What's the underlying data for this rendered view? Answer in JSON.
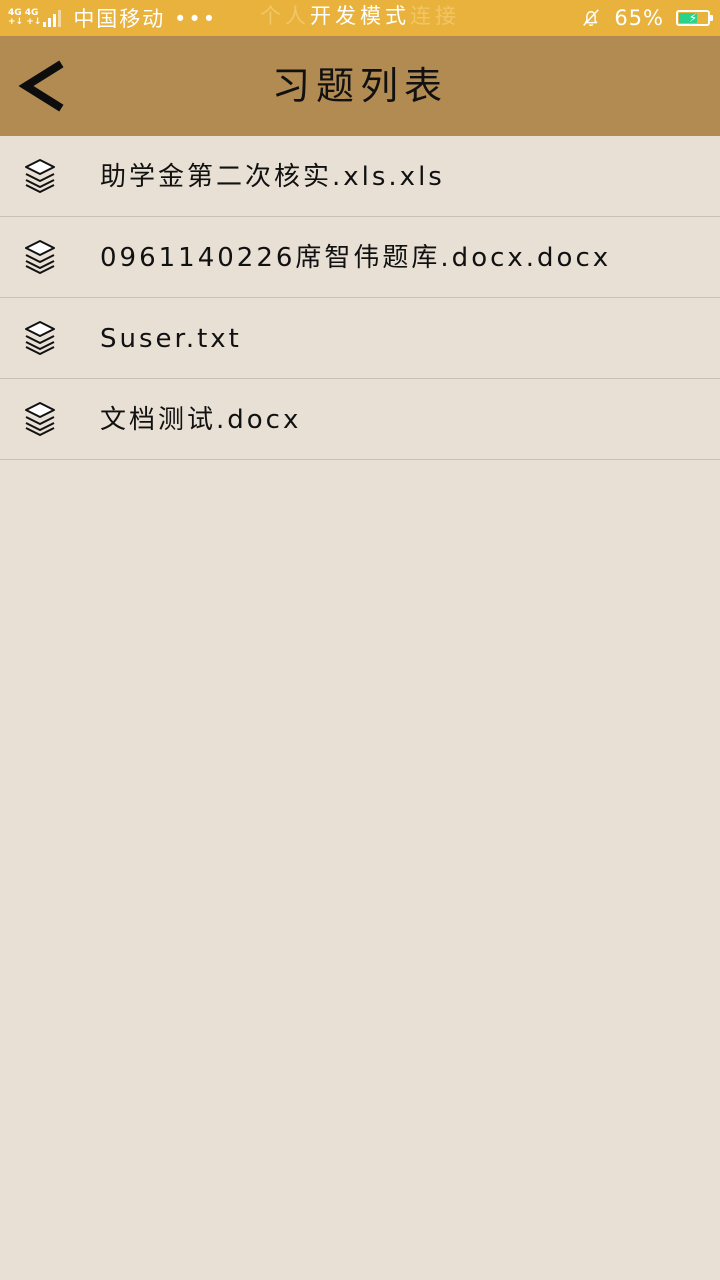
{
  "status_bar": {
    "network_top": "4G 4G",
    "network_bottom": "+↓ +↓",
    "carrier": "中国移动 •••",
    "center_ghost_left": "个人",
    "center_text": "开发模式",
    "center_ghost_right": "连接",
    "battery_percent": "65%",
    "battery_level": 0.65,
    "battery_color": "#2bd38a",
    "icons": [
      "signal-icon",
      "bell-muted-icon",
      "battery-charging-icon"
    ]
  },
  "header": {
    "back_icon": "chevron-left-icon",
    "title": "习题列表",
    "background_color": "#b28b52"
  },
  "files": [
    {
      "icon": "layers-icon",
      "name": "助学金第二次核实.xls.xls"
    },
    {
      "icon": "layers-icon",
      "name": "0961140226席智伟题库.docx.docx"
    },
    {
      "icon": "layers-icon",
      "name": "Suser.txt"
    },
    {
      "icon": "layers-icon",
      "name": "文档测试.docx"
    }
  ],
  "colors": {
    "status_bar": "#e8b23c",
    "page_background": "#e8e0d4",
    "divider": "#c9c1b5"
  }
}
